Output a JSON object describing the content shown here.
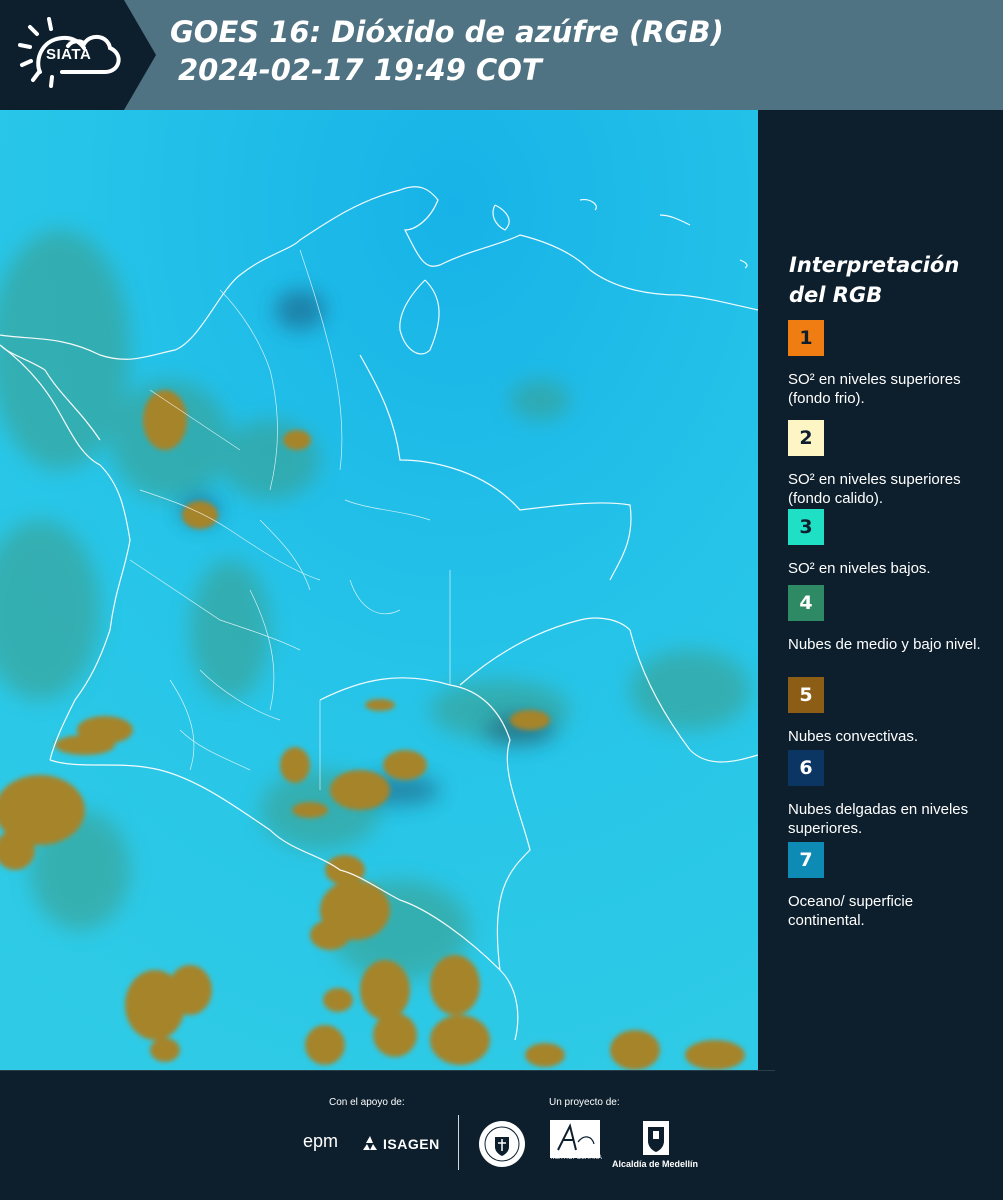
{
  "header": {
    "logo_text": "SIATA",
    "title": "GOES 16: Dióxido de azúfre (RGB)",
    "subtitle": "2024-02-17 19:49 COT"
  },
  "map": {
    "background_color": "#28c6e6",
    "ocean_color": "#1fb9df",
    "cloud_convective_color": "#a5842a",
    "cloud_lowmid_color": "#3d9c86",
    "border_color": "#ffffff",
    "icons": [
      "map-image",
      "country-borders",
      "department-borders",
      "convective-clouds",
      "low-mid-clouds"
    ]
  },
  "legend": {
    "title_line1": "Interpretación",
    "title_line2": "del RGB",
    "items": [
      {
        "number": "1",
        "color": "#f07d12",
        "text_color": "#0d1f2d",
        "label": "SO² en niveles superiores (fondo frio)."
      },
      {
        "number": "2",
        "color": "#fdf5c4",
        "text_color": "#0d1f2d",
        "label": "SO² en niveles superiores (fondo calido)."
      },
      {
        "number": "3",
        "color": "#1fdfc4",
        "text_color": "#0d1f2d",
        "label": "SO² en niveles bajos."
      },
      {
        "number": "4",
        "color": "#2e8a65",
        "text_color": "#ffffff",
        "label": "Nubes de medio y bajo nivel."
      },
      {
        "number": "5",
        "color": "#8c5d14",
        "text_color": "#ffffff",
        "label": "Nubes convectivas."
      },
      {
        "number": "6",
        "color": "#0b3563",
        "text_color": "#ffffff",
        "label": "Nubes delgadas en niveles superiores."
      },
      {
        "number": "7",
        "color": "#0d8bb5",
        "text_color": "#ffffff",
        "label": "Oceano/ superficie continental."
      }
    ]
  },
  "footer": {
    "support_label": "Con el apoyo de:",
    "project_label": "Un proyecto de:",
    "epm": "epm",
    "isagen": "ISAGEN",
    "metro_text": "METROPOLITANA",
    "alcaldia": "Alcaldía de Medellín"
  }
}
